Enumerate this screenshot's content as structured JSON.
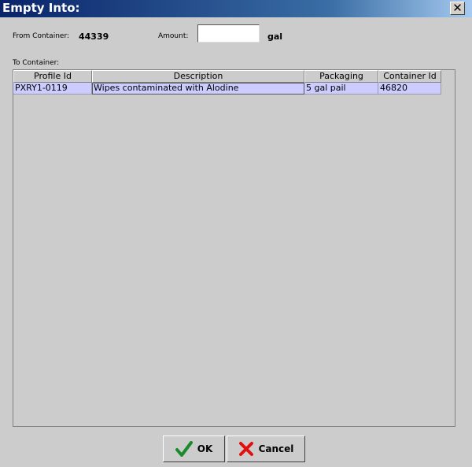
{
  "window": {
    "title": "Empty Into:",
    "close_glyph": "✕"
  },
  "form": {
    "from_container_label": "From Container:",
    "from_container_value": "44339",
    "amount_label": "Amount:",
    "amount_value": "",
    "amount_unit": "gal",
    "to_container_label": "To Container:"
  },
  "table": {
    "columns": [
      "Profile Id",
      "Description",
      "Packaging",
      "Container Id"
    ],
    "rows": [
      [
        "PXRY1-0119",
        "Wipes contaminated with Alodine",
        "5 gal pail",
        "46820"
      ]
    ],
    "row_color": "#ccccff"
  },
  "buttons": {
    "ok_label": "OK",
    "ok_icon": "checkmark-icon",
    "ok_icon_color": "#1a8a2a",
    "cancel_label": "Cancel",
    "cancel_icon": "x-icon",
    "cancel_icon_color": "#e01010"
  }
}
